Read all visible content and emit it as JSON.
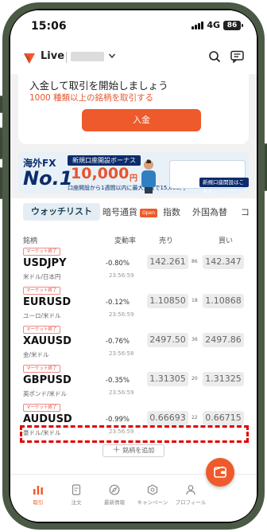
{
  "status_bar": {
    "time": "15:06",
    "network": "4G",
    "battery": "86"
  },
  "header": {
    "account_type": "Live"
  },
  "deposit_card": {
    "title": "入金して取引を開始しましょう",
    "subtitle": "1000 種類以上の銘柄を取引する",
    "button": "入金"
  },
  "banner": {
    "tag": "海外FX",
    "rank": "No.1",
    "heading": "新規口座開設ボーナス",
    "amount": "10,000",
    "unit": "円",
    "line": "口座開設から1週間以内に最大入金で15,000円",
    "cta": "新規口座開設はこちら ›"
  },
  "tabs": [
    {
      "label": "ウォッチリスト"
    },
    {
      "label": "暗号通貨",
      "badge": "Open"
    },
    {
      "label": "指数"
    },
    {
      "label": "外国為替"
    },
    {
      "label": "コ"
    }
  ],
  "list": {
    "headers": {
      "symbol": "銘柄",
      "change": "変動率",
      "sell": "売り",
      "buy": "買い"
    },
    "rows": [
      {
        "tag": "マーケット終了",
        "symbol": "USDJPY",
        "name": "米ドル/日本円",
        "change": "-0.80%",
        "time": "23:56:59",
        "sell": "142.261",
        "spread": "86",
        "buy": "142.347"
      },
      {
        "tag": "マーケット終了",
        "symbol": "EURUSD",
        "name": "ユーロ/米ドル",
        "change": "-0.12%",
        "time": "23:56:59",
        "sell": "1.10850",
        "spread": "18",
        "buy": "1.10868"
      },
      {
        "tag": "マーケット終了",
        "symbol": "XAUUSD",
        "name": "金/米ドル",
        "change": "-0.76%",
        "time": "23:56:58",
        "sell": "2497.50",
        "spread": "36",
        "buy": "2497.86"
      },
      {
        "tag": "マーケット終了",
        "symbol": "GBPUSD",
        "name": "英ポンド/米ドル",
        "change": "-0.35%",
        "time": "23:56:59",
        "sell": "1.31305",
        "spread": "20",
        "buy": "1.31325"
      },
      {
        "tag": "マーケット終了",
        "symbol": "AUDUSD",
        "name": "豪ドル/米ドル",
        "change": "-0.99%",
        "time": "23:56:59",
        "sell": "0.66693",
        "spread": "22",
        "buy": "0.66715"
      }
    ],
    "add_button": "銘柄を追加"
  },
  "bottom_nav": [
    {
      "label": "取引"
    },
    {
      "label": "注文"
    },
    {
      "label": "最新情報"
    },
    {
      "label": "キャンペーン"
    },
    {
      "label": "プロフィール"
    }
  ],
  "colors": {
    "accent": "#ee5a2b",
    "annotation": "#e00000",
    "banner_navy": "#0c2c6b"
  }
}
